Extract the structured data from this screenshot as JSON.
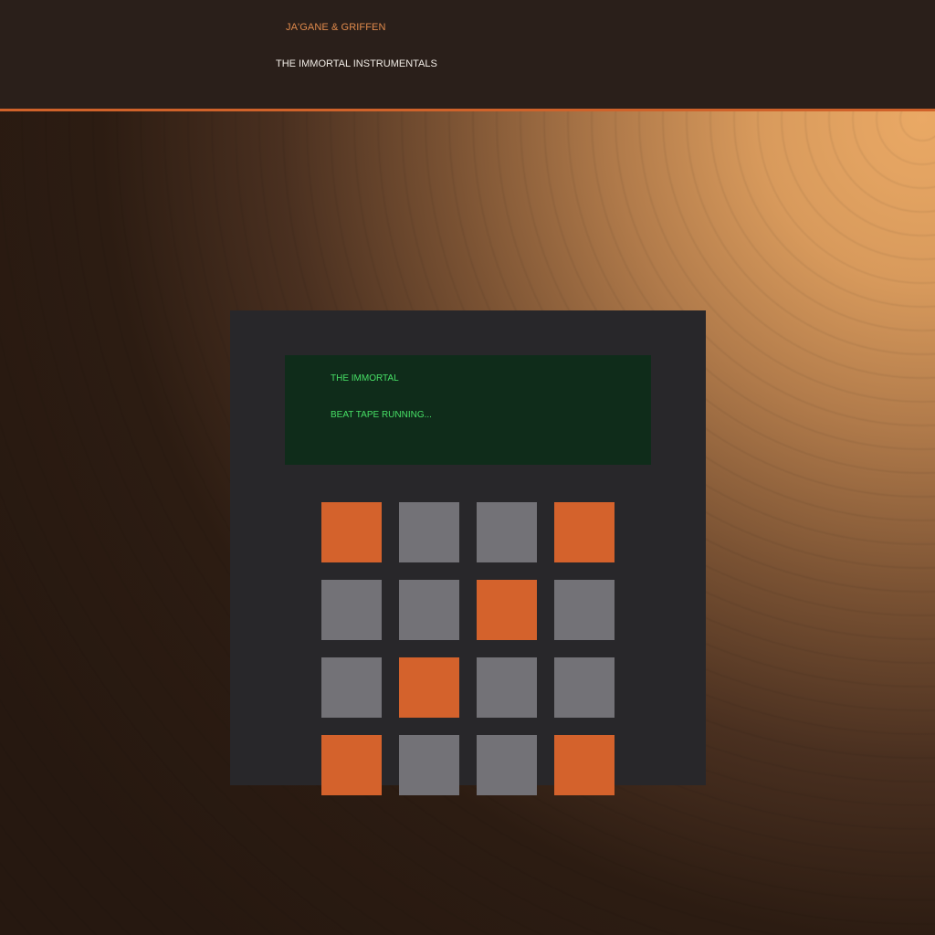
{
  "header": {
    "artist": "JA'GANE & GRIFFEN",
    "album_title": "THE IMMORTAL INSTRUMENTALS"
  },
  "display": {
    "line1": "THE IMMORTAL",
    "line2": "BEAT TAPE RUNNING..."
  },
  "pads": {
    "rows": [
      [
        "on",
        "off",
        "off",
        "on"
      ],
      [
        "off",
        "off",
        "on",
        "off"
      ],
      [
        "off",
        "on",
        "off",
        "off"
      ],
      [
        "on",
        "off",
        "off",
        "on"
      ]
    ]
  },
  "colors": {
    "accent": "#d4622c",
    "pad_off": "#737277",
    "display_text": "#47e066",
    "display_bg": "#0f2c1a",
    "device_body": "#28272a",
    "header_bg": "#2a1f1a"
  }
}
